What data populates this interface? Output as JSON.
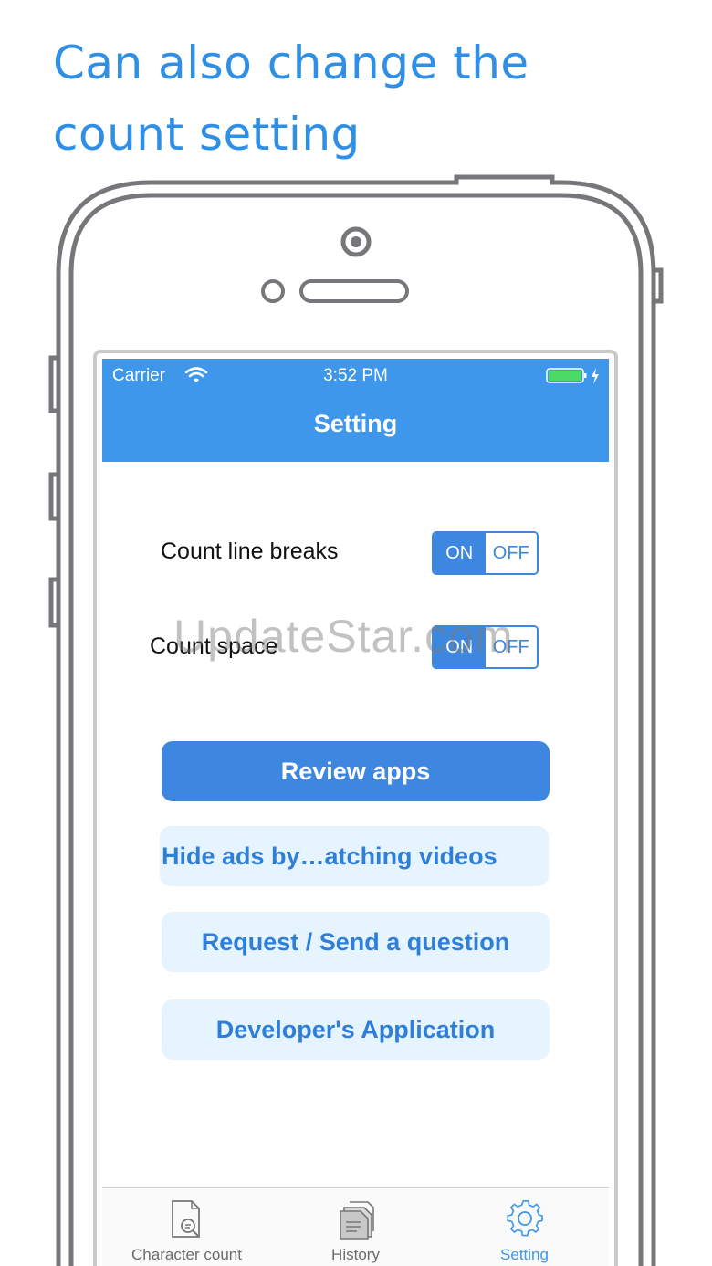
{
  "headline": {
    "line1": "Can also change the",
    "line2": "count setting"
  },
  "status_bar": {
    "carrier": "Carrier",
    "time": "3:52 PM",
    "wifi_icon": "wifi-icon",
    "battery_icon": "battery-charging-icon"
  },
  "nav": {
    "title": "Setting"
  },
  "settings": [
    {
      "label": "Count line breaks",
      "on_label": "ON",
      "off_label": "OFF",
      "selected": "ON"
    },
    {
      "label": "Count space",
      "on_label": "ON",
      "off_label": "OFF",
      "selected": "ON"
    }
  ],
  "buttons": {
    "review": "Review apps",
    "hide_ads": "Hide ads by…atching videos",
    "request": "Request / Send a question",
    "developer": "Developer's Application"
  },
  "tabs": [
    {
      "label": "Character count",
      "icon": "document-search-icon",
      "active": false
    },
    {
      "label": "History",
      "icon": "stacked-documents-icon",
      "active": false
    },
    {
      "label": "Setting",
      "icon": "gear-icon",
      "active": true
    }
  ],
  "watermark": "UpdateStar.com",
  "colors": {
    "accent": "#3e97ea",
    "button_primary": "#3e87e0",
    "button_light": "#e6f4ff",
    "headline": "#2f8fe6"
  }
}
